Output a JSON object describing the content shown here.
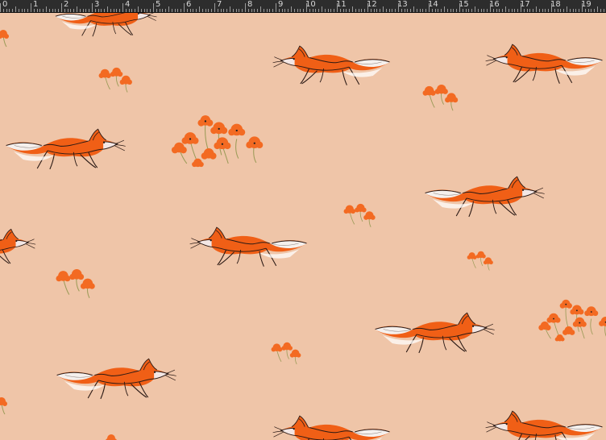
{
  "ruler": {
    "labels": [
      "0",
      "1",
      "2",
      "3",
      "4",
      "5",
      "6",
      "7",
      "8",
      "9",
      "10",
      "11",
      "12",
      "13",
      "14",
      "15",
      "16",
      "17",
      "18",
      "19"
    ]
  },
  "pattern": {
    "name": "fox-and-poppy-pattern",
    "background": "#efc5a8",
    "fox_orange": "#ef6a20",
    "poppy_orange": "#f36a22",
    "stem_color": "#9c9b58"
  }
}
